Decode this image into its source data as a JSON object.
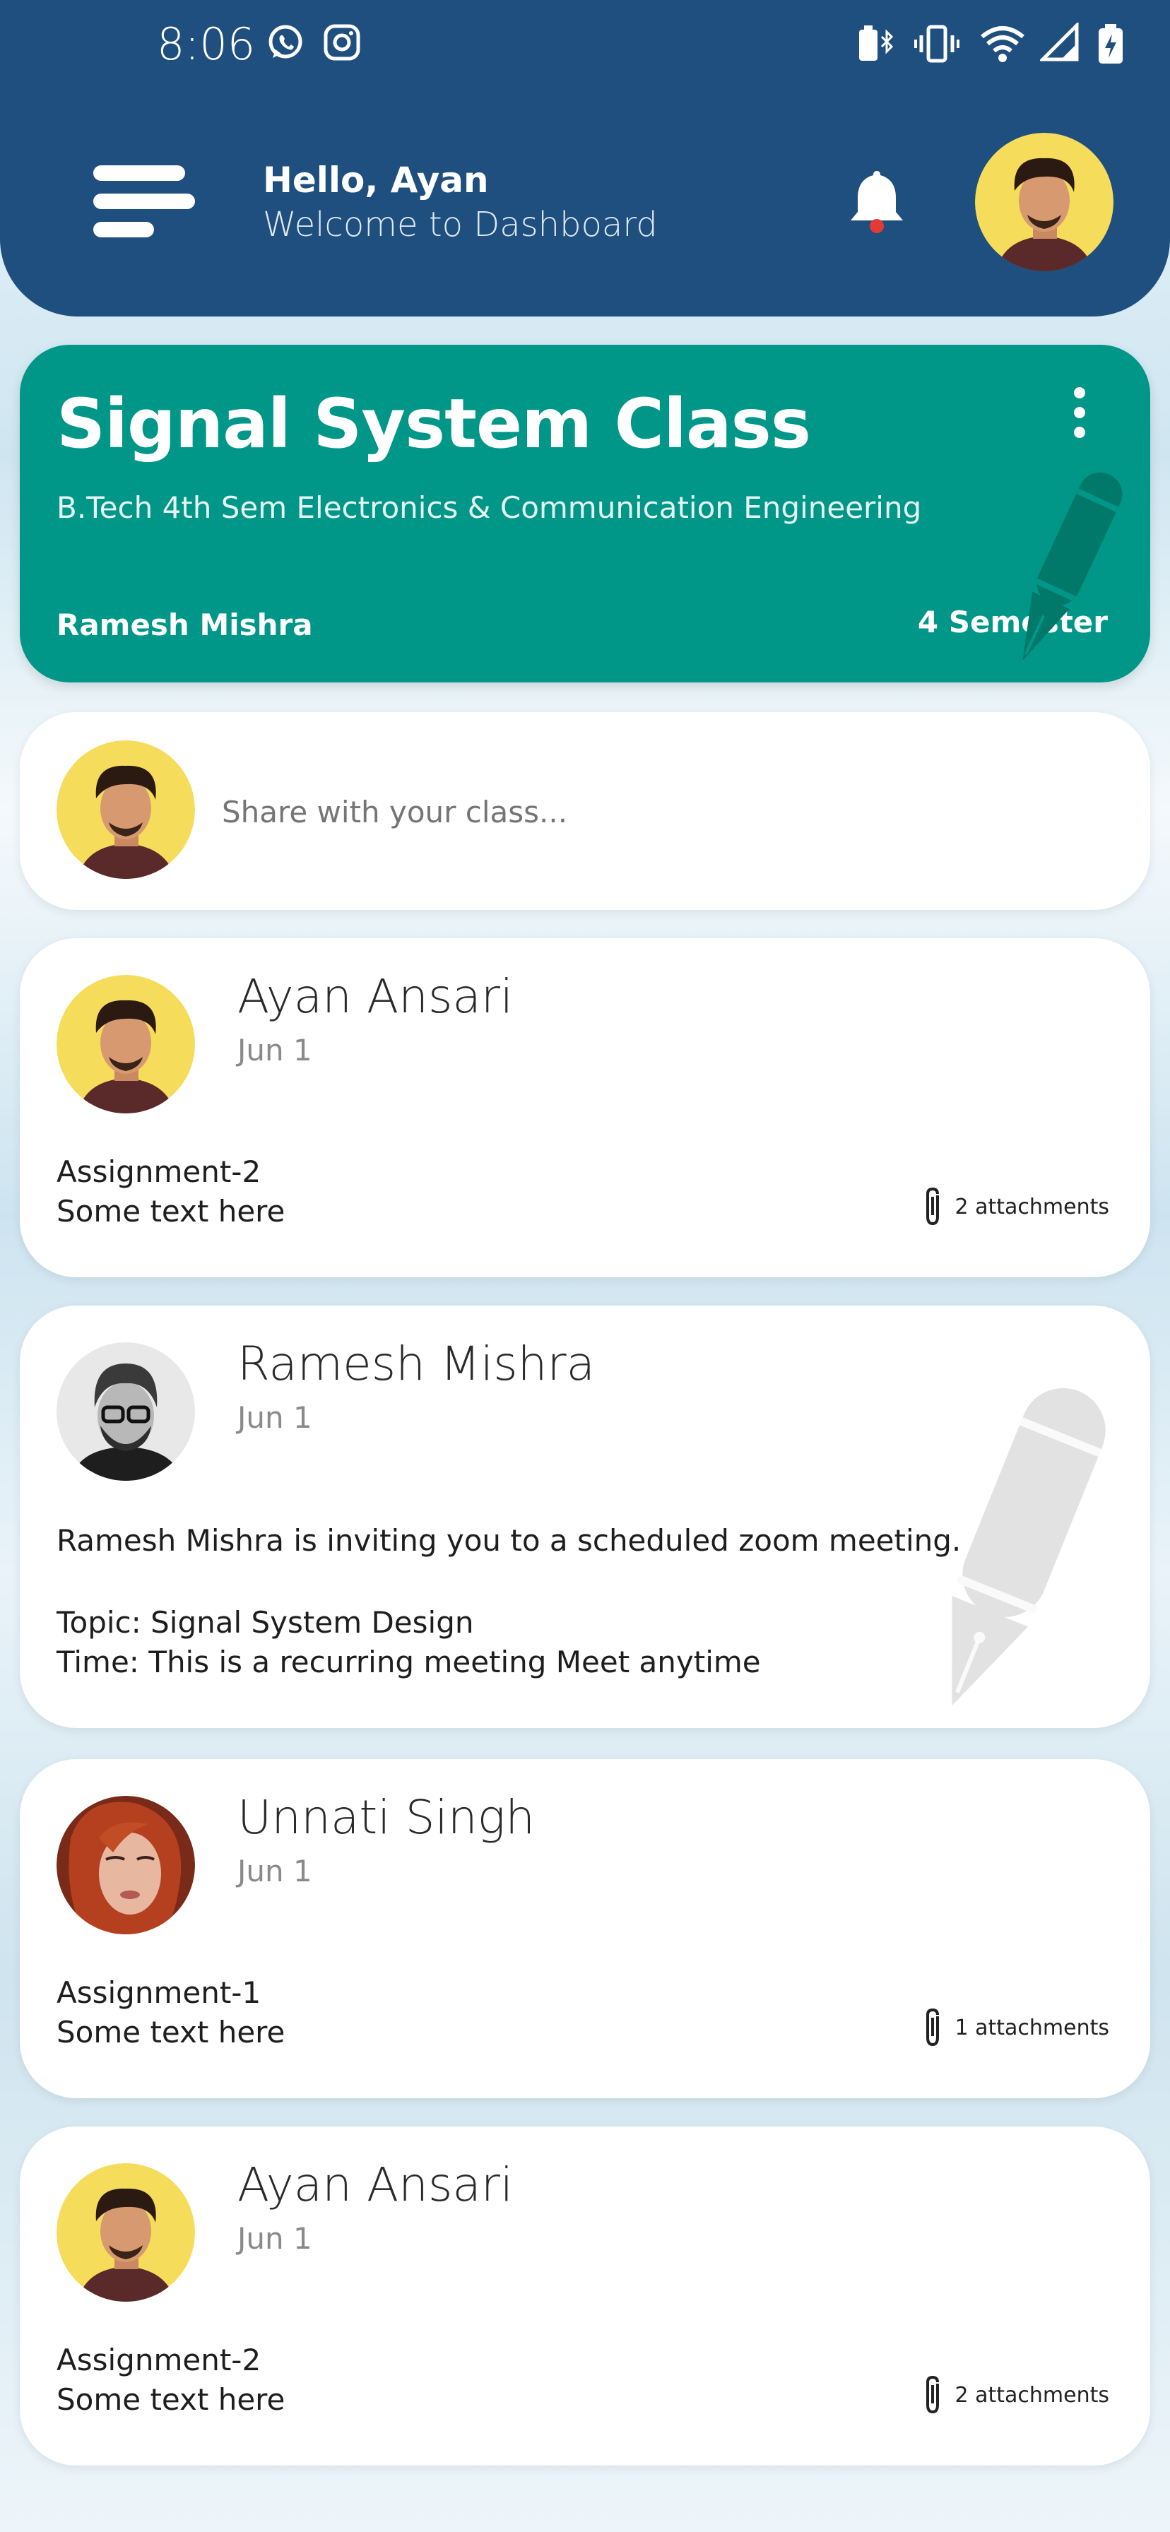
{
  "status_bar": {
    "time": "8:06"
  },
  "header": {
    "greeting": "Hello, Ayan",
    "subtitle": "Welcome to Dashboard"
  },
  "class_banner": {
    "title": "Signal System Class",
    "subtitle": "B.Tech 4th Sem Electronics & Communication Engineering",
    "teacher": "Ramesh Mishra",
    "semester": "4 Semester",
    "color": "#009688"
  },
  "share": {
    "placeholder": "Share with your class..."
  },
  "posts": [
    {
      "author": "Ayan Ansari",
      "date": "Jun 1",
      "line1": "Assignment-2",
      "line2": "Some text here",
      "attachments": "2 attachments"
    },
    {
      "author": "Ramesh Mishra",
      "date": "Jun 1",
      "body1": "Ramesh Mishra is inviting you to a scheduled zoom meeting.",
      "body2": "Topic: Signal System Design",
      "body3": "Time: This is a recurring meeting Meet anytime"
    },
    {
      "author": "Unnati Singh",
      "date": "Jun 1",
      "line1": "Assignment-1",
      "line2": "Some text here",
      "attachments": "1 attachments"
    },
    {
      "author": "Ayan Ansari",
      "date": "Jun 1",
      "line1": "Assignment-2",
      "line2": "Some text here",
      "attachments": "2 attachments"
    }
  ],
  "colors": {
    "header": "#1f4f7e",
    "accent": "#009688"
  }
}
